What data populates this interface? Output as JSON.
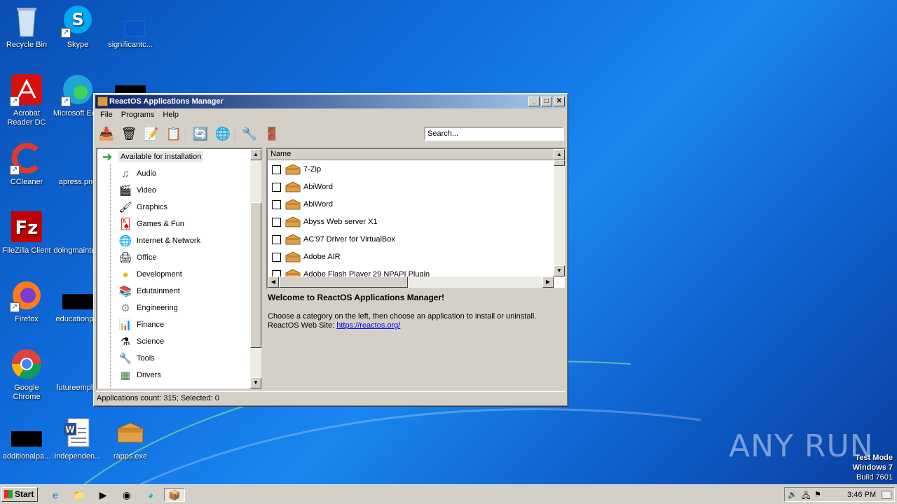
{
  "desktop": {
    "icons": [
      {
        "label": "Recycle Bin"
      },
      {
        "label": "Skype"
      },
      {
        "label": "significantc..."
      },
      {
        "label": "Acrobat Reader DC"
      },
      {
        "label": "Microsoft Ed..."
      },
      {
        "label": "CCleaner"
      },
      {
        "label": "apress.png"
      },
      {
        "label": "FileZilla Client"
      },
      {
        "label": "doingmainte..."
      },
      {
        "label": "Firefox"
      },
      {
        "label": "educationp..."
      },
      {
        "label": "Google Chrome"
      },
      {
        "label": "futureempl..."
      },
      {
        "label": "additionalpa..."
      },
      {
        "label": "independen..."
      },
      {
        "label": "rapps.exe"
      }
    ],
    "watermark": {
      "line1": "Test Mode",
      "line2": "Windows 7",
      "line3": "Build 7601"
    },
    "brand": "ANY RUN"
  },
  "window": {
    "title": "ReactOS Applications Manager",
    "controls": {
      "minimize": "_",
      "maximize": "□",
      "close": "✕"
    },
    "menu": [
      "File",
      "Programs",
      "Help"
    ],
    "search_placeholder": "Search...",
    "tree": {
      "root": "Available for installation",
      "items": [
        {
          "label": "Audio",
          "icon": "music-icon"
        },
        {
          "label": "Video",
          "icon": "clapper-icon"
        },
        {
          "label": "Graphics",
          "icon": "brush-icon"
        },
        {
          "label": "Games & Fun",
          "icon": "cards-icon"
        },
        {
          "label": "Internet & Network",
          "icon": "globe-icon"
        },
        {
          "label": "Office",
          "icon": "office-icon"
        },
        {
          "label": "Development",
          "icon": "development-icon"
        },
        {
          "label": "Edutainment",
          "icon": "books-icon"
        },
        {
          "label": "Engineering",
          "icon": "engineering-icon"
        },
        {
          "label": "Finance",
          "icon": "finance-icon"
        },
        {
          "label": "Science",
          "icon": "science-icon"
        },
        {
          "label": "Tools",
          "icon": "tools-icon"
        },
        {
          "label": "Drivers",
          "icon": "drivers-icon"
        }
      ]
    },
    "list": {
      "column": "Name",
      "rows": [
        "7-Zip",
        "AbiWord",
        "AbiWord",
        "Abyss Web server X1",
        "AC'97 Driver for VirtualBox",
        "Adobe AIR",
        "Adobe Flash Player 29 NPAPI Plugin"
      ]
    },
    "welcome": {
      "title": "Welcome to ReactOS Applications Manager!",
      "line1": "Choose a category on the left, then choose an application to install or uninstall.",
      "line2_prefix": "ReactOS Web Site: ",
      "link": "https://reactos.org/"
    },
    "status": "Applications count: 315; Selected: 0"
  },
  "taskbar": {
    "start": "Start",
    "clock": "3:46 PM"
  }
}
